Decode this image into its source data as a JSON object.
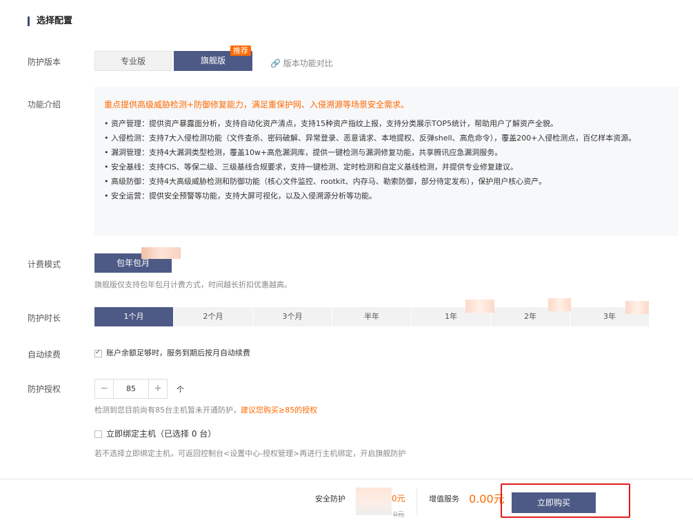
{
  "section_title": "选择配置",
  "version": {
    "label": "防护版本",
    "options": [
      "专业版",
      "旗舰版"
    ],
    "selected": "旗舰版",
    "badge": "推荐",
    "compare_link": "版本功能对比"
  },
  "features": {
    "label": "功能介绍",
    "headline": "重点提供高级威胁检测+防御修复能力，满足重保护网、入侵溯源等场景安全需求。",
    "items": [
      "资产管理：提供资产暴露面分析，支持自动化资产清点，支持15种资产指纹上报，支持分类展示TOP5统计，帮助用户了解资产全貌。",
      "入侵检测：支持7大入侵检测功能（文件查杀、密码破解、异常登录、恶意请求、本地提权、反弹shell、高危命令），覆盖200+入侵检测点，百亿样本资源。",
      "漏洞管理：支持4大漏洞类型检测，覆盖10w+高危漏洞库，提供一键检测与漏洞修复功能，共享腾讯应急漏洞服务。",
      "安全基线：支持CIS、等保二级、三级基线合规要求，支持一键检测、定时检测和自定义基线检测，并提供专业修复建议。",
      "高级防御：支持4大高级威胁检测和防御功能（核心文件监控、rootkit、内存马、勒索防御，部分待定发布），保护用户核心资产。",
      "安全运营：提供安全预警等功能，支持大屏可视化，以及入侵溯源分析等功能。"
    ]
  },
  "billing": {
    "label": "计费模式",
    "option": "包年包月",
    "note": "旗舰版仅支持包年包月计费方式，时间越长折扣优惠越高。"
  },
  "duration": {
    "label": "防护时长",
    "options": [
      "1个月",
      "2个月",
      "3个月",
      "半年",
      "1年",
      "2年",
      "3年"
    ],
    "selected": "1个月"
  },
  "auto_renew": {
    "label": "自动续费",
    "checked": true,
    "text": "账户余额足够时，服务到期后按月自动续费"
  },
  "license": {
    "label": "防护授权",
    "minus": "−",
    "plus": "+",
    "value": "85",
    "unit": "个",
    "note_prefix": "检测到您目前尚有85台主机暂未开通防护，",
    "note_link": "建议您购买≥85的授权"
  },
  "bind_host": {
    "checked": false,
    "text": "立即绑定主机（已选择 0 台）",
    "note": "若不选择立即绑定主机，可返回控制台<设置中心-授权管理>再进行主机绑定，开启旗舰防护"
  },
  "footer": {
    "protection_label": "安全防护",
    "protection_price": "0元",
    "protection_original": "0元",
    "value_added_label": "增值服务",
    "value_added_price": "0.00元",
    "buy_button": "立即购买"
  },
  "colors": {
    "primary": "#4d5a86",
    "accent": "#ff6a00",
    "highlight_box": "#e01a1a"
  }
}
